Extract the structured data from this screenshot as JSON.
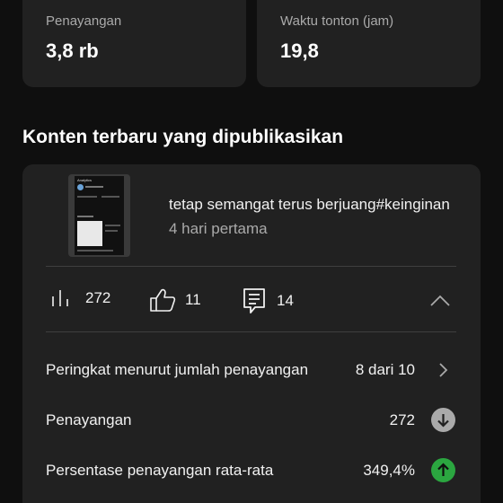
{
  "stats": [
    {
      "label": "Penayangan",
      "value": "3,8 rb"
    },
    {
      "label": "Waktu tonton (jam)",
      "value": "19,8"
    }
  ],
  "section_title": "Konten terbaru yang dipublikasikan",
  "video": {
    "title": "tetap semangat terus berjuang#keinginan",
    "subtitle": "4 hari pertama",
    "thumbnail_text": "Analytics"
  },
  "metrics": {
    "views": "272",
    "likes": "11",
    "comments": "14"
  },
  "rows": [
    {
      "label": "Peringkat menurut jumlah penayangan",
      "value": "8 dari 10",
      "icon": "chevron-right-icon"
    },
    {
      "label": "Penayangan",
      "value": "272",
      "icon": "arrow-down-icon",
      "icon_color": "#aaaaaa"
    },
    {
      "label": "Persentase penayangan rata-rata",
      "value": "349,4%",
      "icon": "arrow-up-icon",
      "icon_color": "#2ba640"
    }
  ],
  "colors": {
    "background": "#0f0f0f",
    "card": "#212121",
    "text_secondary": "#aaaaaa",
    "positive": "#2ba640"
  }
}
